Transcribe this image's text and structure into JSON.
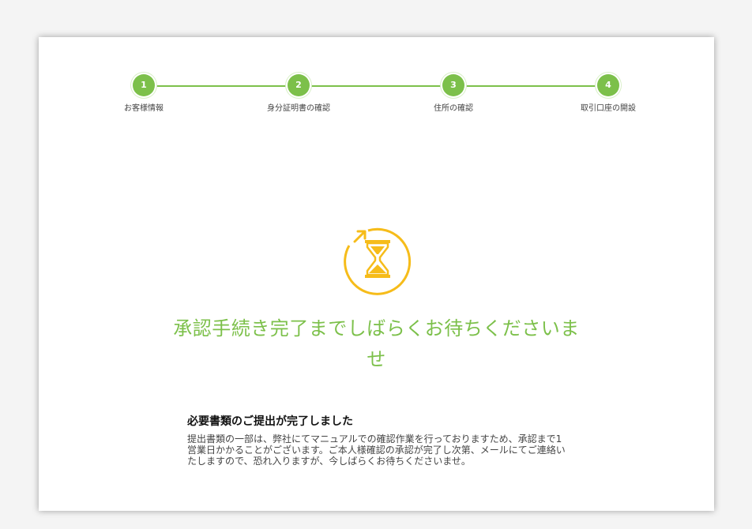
{
  "stepper": {
    "steps": [
      {
        "number": "1",
        "label": "お客様情報"
      },
      {
        "number": "2",
        "label": "身分証明書の確認"
      },
      {
        "number": "3",
        "label": "住所の確認"
      },
      {
        "number": "4",
        "label": "取引口座の開設"
      }
    ]
  },
  "status": {
    "icon": "hourglass-refresh-icon",
    "title": "承認手続き完了までしばらくお待ちくださいませ"
  },
  "notice": {
    "heading": "必要書類のご提出が完了しました",
    "body": "提出書類の一部は、弊社にてマニュアルでの確認作業を行っておりますため、承認まで1営業日かかることがございます。ご本人様確認の承認が完了し次第、メールにてご連絡いたしますので、恐れ入りますが、今しばらくお待ちくださいませ。"
  },
  "colors": {
    "accent_green": "#7cc04a",
    "icon_yellow": "#f6bc1a"
  }
}
